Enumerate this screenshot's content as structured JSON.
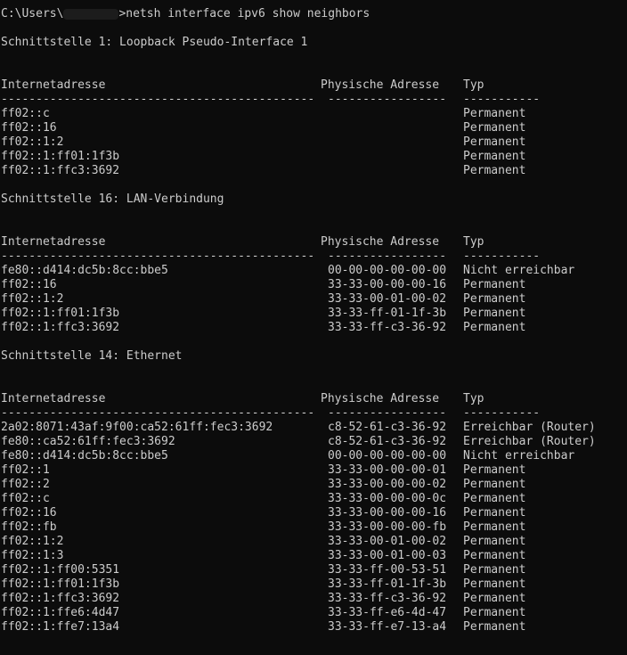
{
  "window": {
    "background": "#0c0c0c",
    "foreground": "#cccccc"
  },
  "prompt": {
    "path_before": "C:\\Users\\",
    "path_after": ">netsh interface ipv6 show neighbors"
  },
  "interfaces": [
    {
      "title": "Schnittstelle 1: Loopback Pseudo-Interface 1",
      "header": {
        "addr": "Internetadresse",
        "mac": "Physische Adresse",
        "typ": "Typ"
      },
      "separator": {
        "addr": "---------------------------------------------",
        "mac": "-----------------",
        "typ": "-----------"
      },
      "rows": [
        {
          "addr": "ff02::c",
          "mac": "",
          "typ": "Permanent"
        },
        {
          "addr": "ff02::16",
          "mac": "",
          "typ": "Permanent"
        },
        {
          "addr": "ff02::1:2",
          "mac": "",
          "typ": "Permanent"
        },
        {
          "addr": "ff02::1:ff01:1f3b",
          "mac": "",
          "typ": "Permanent"
        },
        {
          "addr": "ff02::1:ffc3:3692",
          "mac": "",
          "typ": "Permanent"
        }
      ]
    },
    {
      "title": "Schnittstelle 16: LAN-Verbindung",
      "header": {
        "addr": "Internetadresse",
        "mac": "Physische Adresse",
        "typ": "Typ"
      },
      "separator": {
        "addr": "---------------------------------------------",
        "mac": "-----------------",
        "typ": "-----------"
      },
      "rows": [
        {
          "addr": "fe80::d414:dc5b:8cc:bbe5",
          "mac": "00-00-00-00-00-00",
          "typ": "Nicht erreichbar"
        },
        {
          "addr": "ff02::16",
          "mac": "33-33-00-00-00-16",
          "typ": "Permanent"
        },
        {
          "addr": "ff02::1:2",
          "mac": "33-33-00-01-00-02",
          "typ": "Permanent"
        },
        {
          "addr": "ff02::1:ff01:1f3b",
          "mac": "33-33-ff-01-1f-3b",
          "typ": "Permanent"
        },
        {
          "addr": "ff02::1:ffc3:3692",
          "mac": "33-33-ff-c3-36-92",
          "typ": "Permanent"
        }
      ]
    },
    {
      "title": "Schnittstelle 14: Ethernet",
      "header": {
        "addr": "Internetadresse",
        "mac": "Physische Adresse",
        "typ": "Typ"
      },
      "separator": {
        "addr": "---------------------------------------------",
        "mac": "-----------------",
        "typ": "-----------"
      },
      "rows": [
        {
          "addr": "2a02:8071:43af:9f00:ca52:61ff:fec3:3692",
          "mac": "c8-52-61-c3-36-92",
          "typ": "Erreichbar (Router)"
        },
        {
          "addr": "fe80::ca52:61ff:fec3:3692",
          "mac": "c8-52-61-c3-36-92",
          "typ": "Erreichbar (Router)"
        },
        {
          "addr": "fe80::d414:dc5b:8cc:bbe5",
          "mac": "00-00-00-00-00-00",
          "typ": "Nicht erreichbar"
        },
        {
          "addr": "ff02::1",
          "mac": "33-33-00-00-00-01",
          "typ": "Permanent"
        },
        {
          "addr": "ff02::2",
          "mac": "33-33-00-00-00-02",
          "typ": "Permanent"
        },
        {
          "addr": "ff02::c",
          "mac": "33-33-00-00-00-0c",
          "typ": "Permanent"
        },
        {
          "addr": "ff02::16",
          "mac": "33-33-00-00-00-16",
          "typ": "Permanent"
        },
        {
          "addr": "ff02::fb",
          "mac": "33-33-00-00-00-fb",
          "typ": "Permanent"
        },
        {
          "addr": "ff02::1:2",
          "mac": "33-33-00-01-00-02",
          "typ": "Permanent"
        },
        {
          "addr": "ff02::1:3",
          "mac": "33-33-00-01-00-03",
          "typ": "Permanent"
        },
        {
          "addr": "ff02::1:ff00:5351",
          "mac": "33-33-ff-00-53-51",
          "typ": "Permanent"
        },
        {
          "addr": "ff02::1:ff01:1f3b",
          "mac": "33-33-ff-01-1f-3b",
          "typ": "Permanent"
        },
        {
          "addr": "ff02::1:ffc3:3692",
          "mac": "33-33-ff-c3-36-92",
          "typ": "Permanent"
        },
        {
          "addr": "ff02::1:ffe6:4d47",
          "mac": "33-33-ff-e6-4d-47",
          "typ": "Permanent"
        },
        {
          "addr": "ff02::1:ffe7:13a4",
          "mac": "33-33-ff-e7-13-a4",
          "typ": "Permanent"
        }
      ]
    }
  ]
}
